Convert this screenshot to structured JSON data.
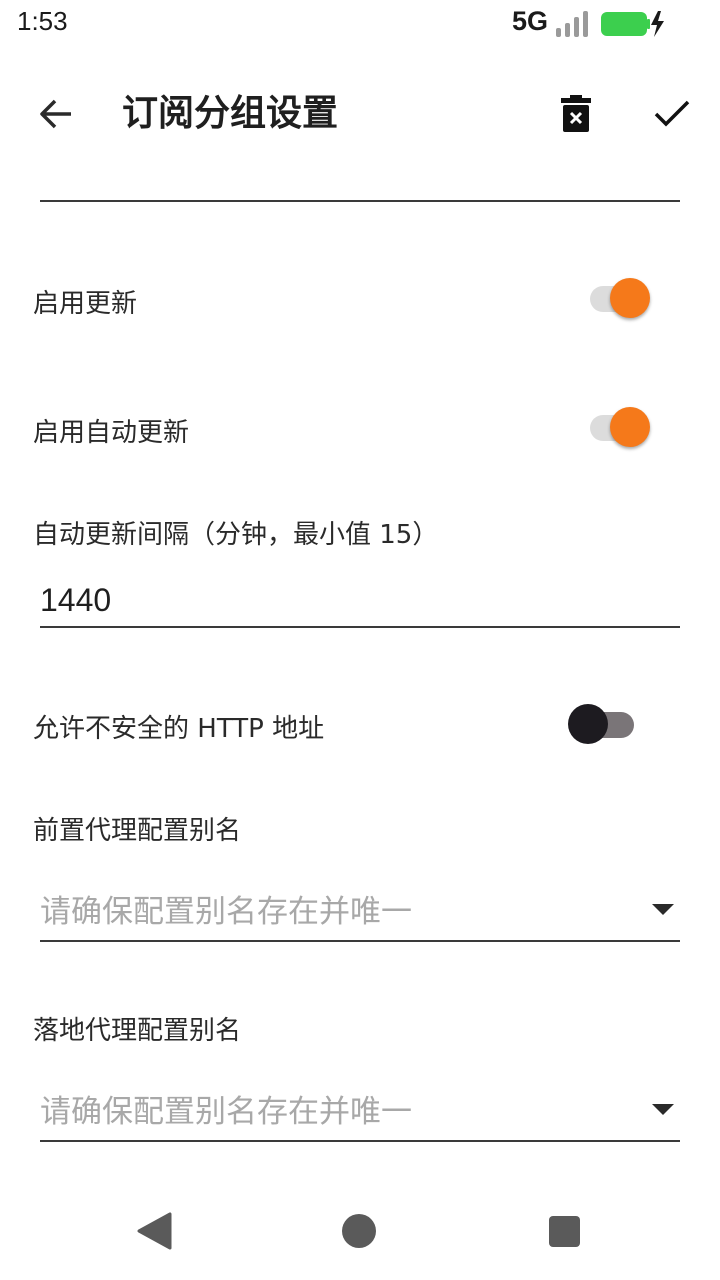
{
  "status_bar": {
    "time": "1:53",
    "network": "5G",
    "battery_color": "#3ccf4e"
  },
  "app_bar": {
    "title": "订阅分组设置",
    "back_icon": "arrow-left-icon",
    "delete_icon": "trash-x-icon",
    "confirm_icon": "check-icon"
  },
  "settings": {
    "enable_update": {
      "label": "启用更新",
      "checked": true
    },
    "enable_auto_update": {
      "label": "启用自动更新",
      "checked": true
    },
    "auto_update_interval": {
      "label": "自动更新间隔（分钟，最小值 15）",
      "value": "1440"
    },
    "allow_insecure_http": {
      "label": "允许不安全的 HTTP 地址",
      "checked": false
    },
    "front_proxy_alias": {
      "label": "前置代理配置别名",
      "placeholder": "请确保配置别名存在并唯一"
    },
    "landing_proxy_alias": {
      "label": "落地代理配置别名",
      "placeholder": "请确保配置别名存在并唯一"
    }
  },
  "colors": {
    "accent": "#f5791a",
    "switch_off_thumb": "#1d1b20",
    "switch_off_track": "#7a7578"
  },
  "nav_bar": {
    "back_icon": "triangle-back-icon",
    "home_icon": "circle-home-icon",
    "recents_icon": "square-recents-icon"
  }
}
